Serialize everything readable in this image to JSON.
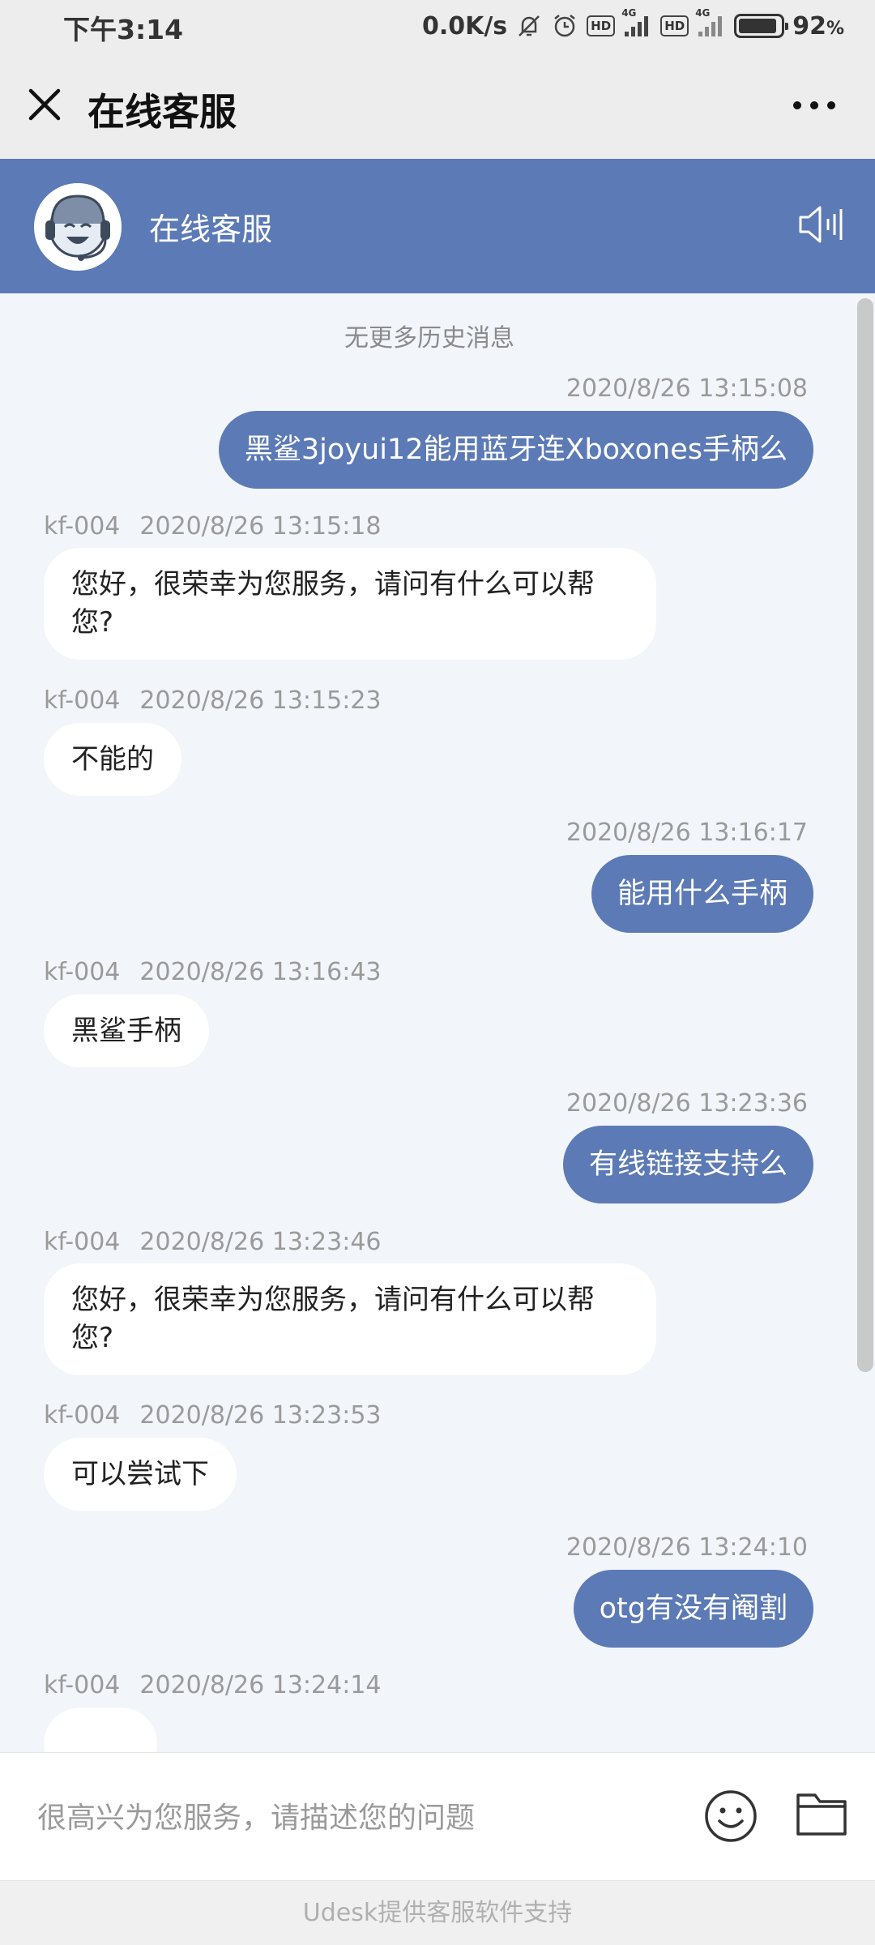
{
  "status_bar": {
    "time": "下午3:14",
    "net_speed": "0.0K/s",
    "hd1": "HD",
    "net1": "4G",
    "hd2": "HD",
    "net2": "4G",
    "battery": "92",
    "battery_unit": "%",
    "battery_level": 0.92,
    "icons": [
      "mute-bell-icon",
      "alarm-icon",
      "signal-icon",
      "battery-icon"
    ]
  },
  "app_bar": {
    "title": "在线客服",
    "icons": [
      "close-icon",
      "more-icon"
    ]
  },
  "chat_header": {
    "agent_name": "在线客服",
    "icons": [
      "agent-avatar",
      "speaker-icon"
    ]
  },
  "chat": {
    "no_more": "无更多历史消息",
    "messages": [
      {
        "side": "out",
        "time": "2020/8/26 13:15:08",
        "text": "黑鲨3joyui12能用蓝牙连Xboxones手柄么"
      },
      {
        "side": "in",
        "agent": "kf-004",
        "time": "2020/8/26 13:15:18",
        "text": "您好，很荣幸为您服务，请问有什么可以帮您?"
      },
      {
        "side": "in",
        "agent": "kf-004",
        "time": "2020/8/26 13:15:23",
        "text": "不能的"
      },
      {
        "side": "out",
        "time": "2020/8/26 13:16:17",
        "text": "能用什么手柄"
      },
      {
        "side": "in",
        "agent": "kf-004",
        "time": "2020/8/26 13:16:43",
        "text": "黑鲨手柄"
      },
      {
        "side": "out",
        "time": "2020/8/26 13:23:36",
        "text": "有线链接支持么"
      },
      {
        "side": "in",
        "agent": "kf-004",
        "time": "2020/8/26 13:23:46",
        "text": "您好，很荣幸为您服务，请问有什么可以帮您?"
      },
      {
        "side": "in",
        "agent": "kf-004",
        "time": "2020/8/26 13:23:53",
        "text": "可以尝试下"
      },
      {
        "side": "out",
        "time": "2020/8/26 13:24:10",
        "text": "otg有没有阉割"
      },
      {
        "side": "in",
        "agent": "kf-004",
        "time": "2020/8/26 13:24:14",
        "text": ""
      }
    ]
  },
  "input": {
    "placeholder": "很高兴为您服务，请描述您的问题",
    "icons": [
      "emoji-icon",
      "folder-icon"
    ]
  },
  "footer": {
    "text": "Udesk提供客服软件支持"
  },
  "colors": {
    "accent": "#5c7ab5",
    "chat_bg": "#f2f5f9",
    "bar_bg": "#ededed"
  }
}
